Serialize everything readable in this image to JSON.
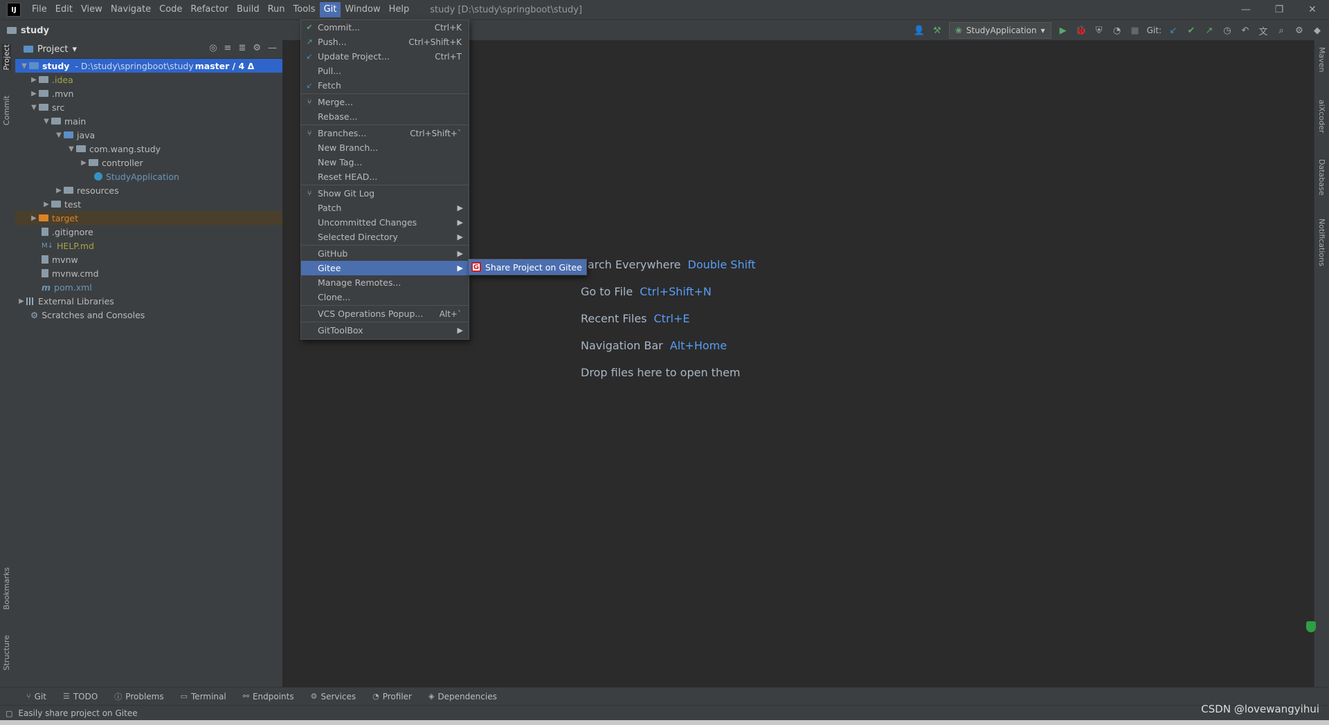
{
  "menubar": {
    "logo": "IJ",
    "items": [
      "File",
      "Edit",
      "View",
      "Navigate",
      "Code",
      "Refactor",
      "Build",
      "Run",
      "Tools",
      "Git",
      "Window",
      "Help"
    ],
    "window_title": "study [D:\\study\\springboot\\study]"
  },
  "navbar": {
    "project": "study",
    "run_config": "StudyApplication",
    "git_label": "Git:"
  },
  "project_panel": {
    "title": "Project",
    "rows": [
      {
        "name": "study",
        "path": "- D:\\study\\springboot\\study",
        "branch": "master / 4 Δ"
      },
      {
        "name": ".idea"
      },
      {
        "name": ".mvn"
      },
      {
        "name": "src"
      },
      {
        "name": "main"
      },
      {
        "name": "java"
      },
      {
        "name": "com.wang.study"
      },
      {
        "name": "controller"
      },
      {
        "name": "StudyApplication"
      },
      {
        "name": "resources"
      },
      {
        "name": "test"
      },
      {
        "name": "target"
      },
      {
        "name": ".gitignore"
      },
      {
        "name": "HELP.md"
      },
      {
        "name": "mvnw"
      },
      {
        "name": "mvnw.cmd"
      },
      {
        "name": "pom.xml"
      },
      {
        "name": "External Libraries"
      },
      {
        "name": "Scratches and Consoles"
      }
    ]
  },
  "git_menu": {
    "items": [
      {
        "label": "Commit...",
        "shortcut": "Ctrl+K"
      },
      {
        "label": "Push...",
        "shortcut": "Ctrl+Shift+K"
      },
      {
        "label": "Update Project...",
        "shortcut": "Ctrl+T"
      },
      {
        "label": "Pull..."
      },
      {
        "label": "Fetch"
      },
      {
        "label": "Merge..."
      },
      {
        "label": "Rebase..."
      },
      {
        "label": "Branches...",
        "shortcut": "Ctrl+Shift+`"
      },
      {
        "label": "New Branch..."
      },
      {
        "label": "New Tag..."
      },
      {
        "label": "Reset HEAD..."
      },
      {
        "label": "Show Git Log"
      },
      {
        "label": "Patch"
      },
      {
        "label": "Uncommitted Changes"
      },
      {
        "label": "Selected Directory"
      },
      {
        "label": "GitHub"
      },
      {
        "label": "Gitee"
      },
      {
        "label": "Manage Remotes..."
      },
      {
        "label": "Clone..."
      },
      {
        "label": "VCS Operations Popup...",
        "shortcut": "Alt+`"
      },
      {
        "label": "GitToolBox"
      }
    ]
  },
  "gitee_submenu": {
    "item": "Share Project on Gitee"
  },
  "welcome": {
    "hints": [
      {
        "label": "earch Everywhere",
        "key": "Double Shift"
      },
      {
        "label": "Go to File",
        "key": "Ctrl+Shift+N"
      },
      {
        "label": "Recent Files",
        "key": "Ctrl+E"
      },
      {
        "label": "Navigation Bar",
        "key": "Alt+Home"
      },
      {
        "label": "Drop files here to open them",
        "key": ""
      }
    ]
  },
  "left_tabs": [
    "Project",
    "Commit",
    "Bookmarks",
    "Structure"
  ],
  "right_tabs": [
    "Maven",
    "aiXcoder",
    "Database",
    "Notifications"
  ],
  "bottom_tools": [
    "Git",
    "TODO",
    "Problems",
    "Terminal",
    "Endpoints",
    "Services",
    "Profiler",
    "Dependencies"
  ],
  "status": {
    "message": "Easily share project on Gitee",
    "watermark": "CSDN @lovewangyihui"
  },
  "colors": {
    "accent": "#4b6eaf",
    "selection": "#2f65ca",
    "hint_key": "#589df6",
    "gitee": "#c71d23"
  }
}
